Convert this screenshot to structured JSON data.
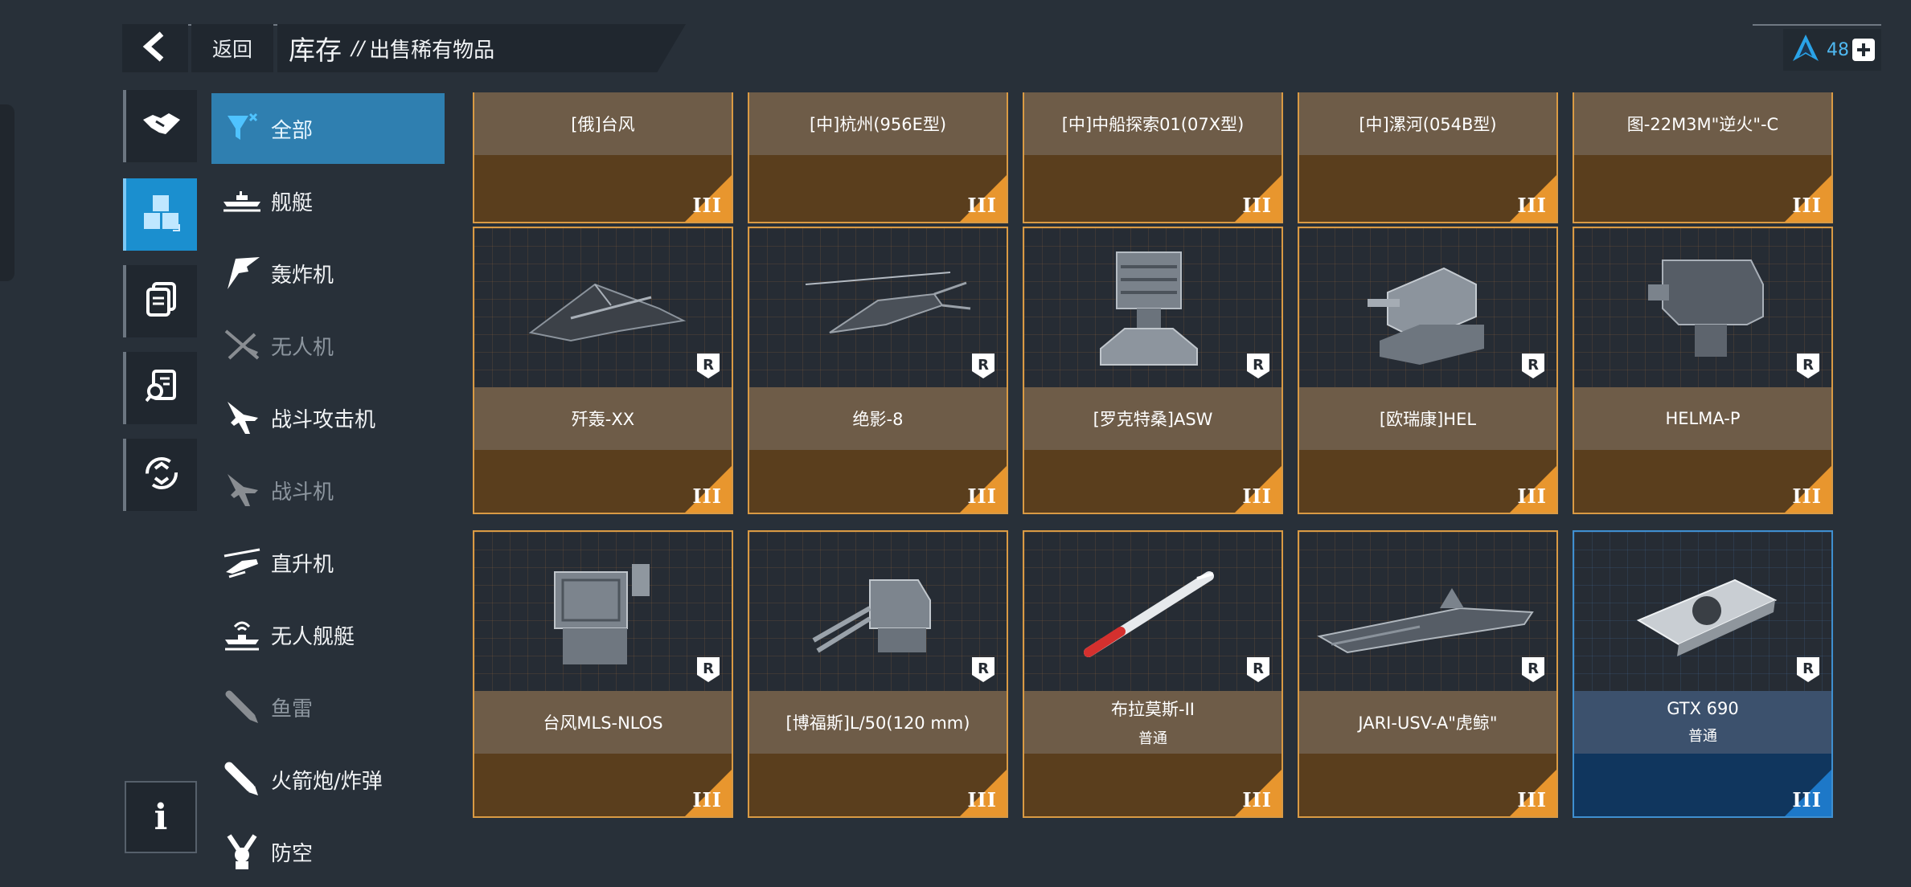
{
  "header": {
    "back_label": "返回",
    "title": "库存",
    "separator": "//",
    "subtitle": "出售稀有物品"
  },
  "currency": {
    "amount": "48",
    "icon": "rank-a-icon"
  },
  "sidebar": {
    "buttons": [
      {
        "name": "trade-icon",
        "active": false
      },
      {
        "name": "inventory-cubes-icon",
        "active": true
      },
      {
        "name": "cards-icon",
        "active": false
      },
      {
        "name": "search-document-icon",
        "active": false
      },
      {
        "name": "recycle-icon",
        "active": false
      }
    ],
    "info_label": "i"
  },
  "categories": [
    {
      "label": "全部",
      "active": true,
      "dim": false,
      "icon": "all-filter-icon"
    },
    {
      "label": "舰艇",
      "active": false,
      "dim": false,
      "icon": "ship-icon"
    },
    {
      "label": "轰炸机",
      "active": false,
      "dim": false,
      "icon": "bomber-icon"
    },
    {
      "label": "无人机",
      "active": false,
      "dim": true,
      "icon": "drone-icon"
    },
    {
      "label": "战斗攻击机",
      "active": false,
      "dim": false,
      "icon": "attack-jet-icon"
    },
    {
      "label": "战斗机",
      "active": false,
      "dim": true,
      "icon": "fighter-icon"
    },
    {
      "label": "直升机",
      "active": false,
      "dim": false,
      "icon": "helicopter-icon"
    },
    {
      "label": "无人舰艇",
      "active": false,
      "dim": false,
      "icon": "unmanned-ship-icon"
    },
    {
      "label": "鱼雷",
      "active": false,
      "dim": true,
      "icon": "torpedo-icon"
    },
    {
      "label": "火箭炮/炸弹",
      "active": false,
      "dim": false,
      "icon": "rocket-icon"
    },
    {
      "label": "防空",
      "active": false,
      "dim": false,
      "icon": "anti-air-icon"
    }
  ],
  "items_top_row": [
    {
      "name": "[俄]台风",
      "tier": "III"
    },
    {
      "name": "[中]杭州(956E型)",
      "tier": "III"
    },
    {
      "name": "[中]中船探索01(07X型)",
      "tier": "III"
    },
    {
      "name": "[中]漯河(054B型)",
      "tier": "III"
    },
    {
      "name": "图-22M3M\"逆火\"-C",
      "tier": "III"
    }
  ],
  "items": [
    {
      "name": "歼轰-XX",
      "sub": "",
      "tier": "III",
      "badge": "R",
      "image": "stealth-bomber",
      "rarity": "orange"
    },
    {
      "name": "绝影-8",
      "sub": "",
      "tier": "III",
      "badge": "R",
      "image": "helicopter",
      "rarity": "orange"
    },
    {
      "name": "[罗克特桑]ASW",
      "sub": "",
      "tier": "III",
      "badge": "R",
      "image": "rocket-launcher",
      "rarity": "orange"
    },
    {
      "name": "[欧瑞康]HEL",
      "sub": "",
      "tier": "III",
      "badge": "R",
      "image": "laser-turret",
      "rarity": "orange"
    },
    {
      "name": "HELMA-P",
      "sub": "",
      "tier": "III",
      "badge": "R",
      "image": "laser-mount",
      "rarity": "orange"
    },
    {
      "name": "台风MLS-NLOS",
      "sub": "",
      "tier": "III",
      "badge": "R",
      "image": "missile-launcher",
      "rarity": "orange"
    },
    {
      "name": "[博福斯]L/50(120 mm)",
      "sub": "",
      "tier": "III",
      "badge": "R",
      "image": "naval-gun",
      "rarity": "orange"
    },
    {
      "name": "布拉莫斯-II",
      "sub": "普通",
      "tier": "III",
      "badge": "R",
      "image": "cruise-missile",
      "rarity": "orange"
    },
    {
      "name": "JARI-USV-A\"虎鲸\"",
      "sub": "",
      "tier": "III",
      "badge": "R",
      "image": "usv-ship",
      "rarity": "orange"
    },
    {
      "name": "GTX 690",
      "sub": "普通",
      "tier": "III",
      "badge": "R",
      "image": "graphics-card",
      "rarity": "blue"
    }
  ],
  "colors": {
    "background": "#283039",
    "accent_blue": "#1b8fcf",
    "rare_orange": "#e8962e",
    "card_name_bg": "#6e5c48"
  }
}
